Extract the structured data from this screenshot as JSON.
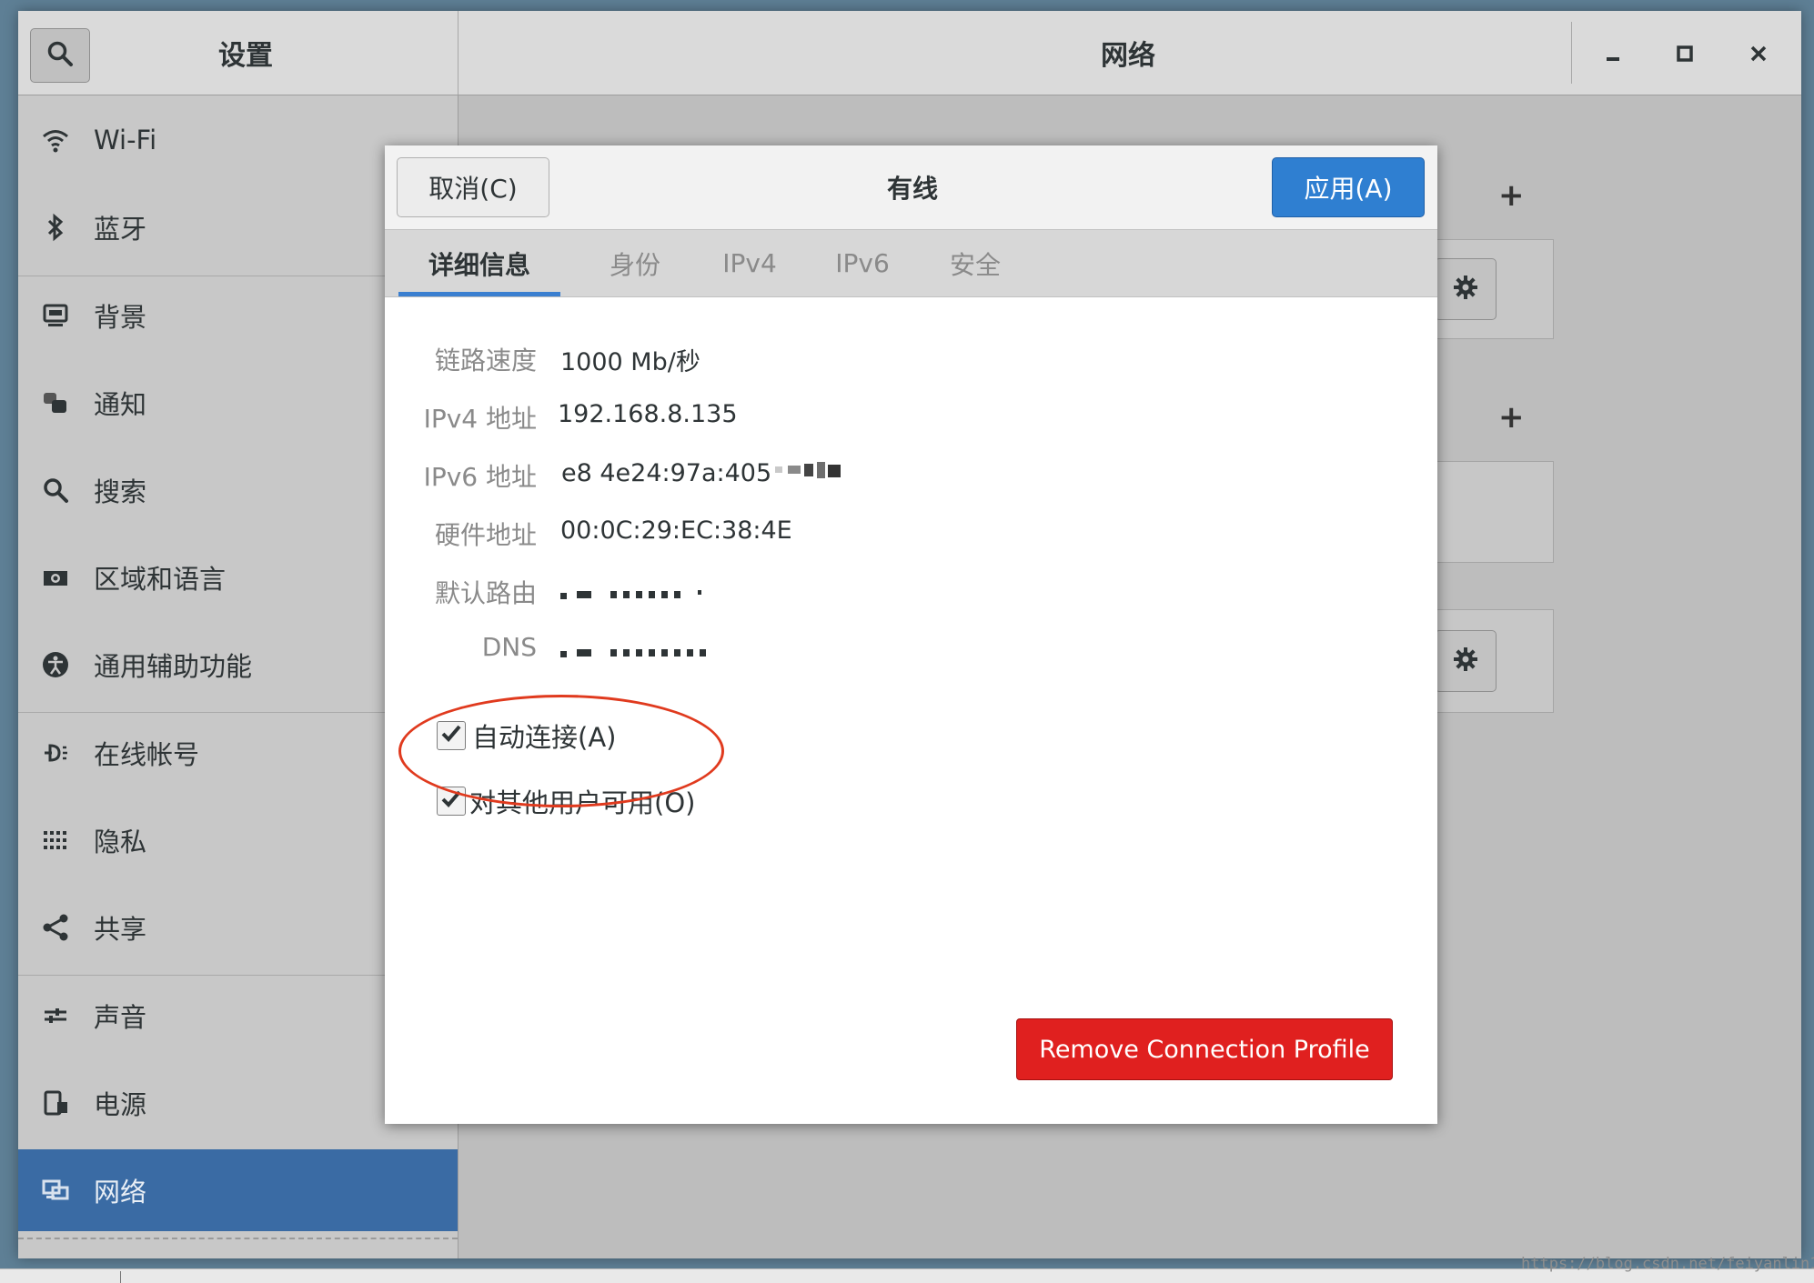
{
  "app": {
    "sidebar_title": "设置",
    "main_title": "网络",
    "window_controls": {
      "minimize": "_",
      "maximize": "◻",
      "close": "✕"
    }
  },
  "sidebar": {
    "items": [
      {
        "label": "Wi-Fi",
        "icon": "wifi-icon"
      },
      {
        "label": "蓝牙",
        "icon": "bluetooth-icon"
      },
      {
        "label": "背景",
        "icon": "background-icon"
      },
      {
        "label": "通知",
        "icon": "notification-icon"
      },
      {
        "label": "搜索",
        "icon": "search-icon"
      },
      {
        "label": "区域和语言",
        "icon": "region-icon"
      },
      {
        "label": "通用辅助功能",
        "icon": "accessibility-icon"
      },
      {
        "label": "在线帐号",
        "icon": "online-accounts-icon"
      },
      {
        "label": "隐私",
        "icon": "privacy-icon"
      },
      {
        "label": "共享",
        "icon": "share-icon"
      },
      {
        "label": "声音",
        "icon": "sound-icon"
      },
      {
        "label": "电源",
        "icon": "power-icon"
      },
      {
        "label": "网络",
        "icon": "network-icon",
        "active": true
      }
    ]
  },
  "content": {
    "add_symbol": "+"
  },
  "dialog": {
    "cancel_label": "取消(C)",
    "title": "有线",
    "apply_label": "应用(A)",
    "tabs": [
      {
        "label": "详细信息",
        "active": true
      },
      {
        "label": "身份"
      },
      {
        "label": "IPv4"
      },
      {
        "label": "IPv6"
      },
      {
        "label": "安全"
      }
    ],
    "details": {
      "link_speed_label": "链路速度",
      "link_speed_value": "1000 Mb/秒",
      "ipv4_label": "IPv4 地址",
      "ipv4_value": "192.168.8.135",
      "ipv6_label": "IPv6 地址",
      "ipv6_value_visible": "e8 4e24:97a:405",
      "hw_label": "硬件地址",
      "hw_value": "00:0C:29:EC:38:4E",
      "route_label": "默认路由",
      "dns_label": "DNS"
    },
    "auto_connect_label": "自动连接(A)",
    "auto_connect_checked": true,
    "all_users_label": "对其他用户可用(O)",
    "all_users_checked": true,
    "remove_label": "Remove Connection Profile"
  },
  "colors": {
    "accent": "#3a6ba4",
    "apply": "#2f7fd1",
    "danger": "#e0201f",
    "annotation": "#e03a1e"
  },
  "watermark": "https://blog.csdn.net/feiyanlin1"
}
